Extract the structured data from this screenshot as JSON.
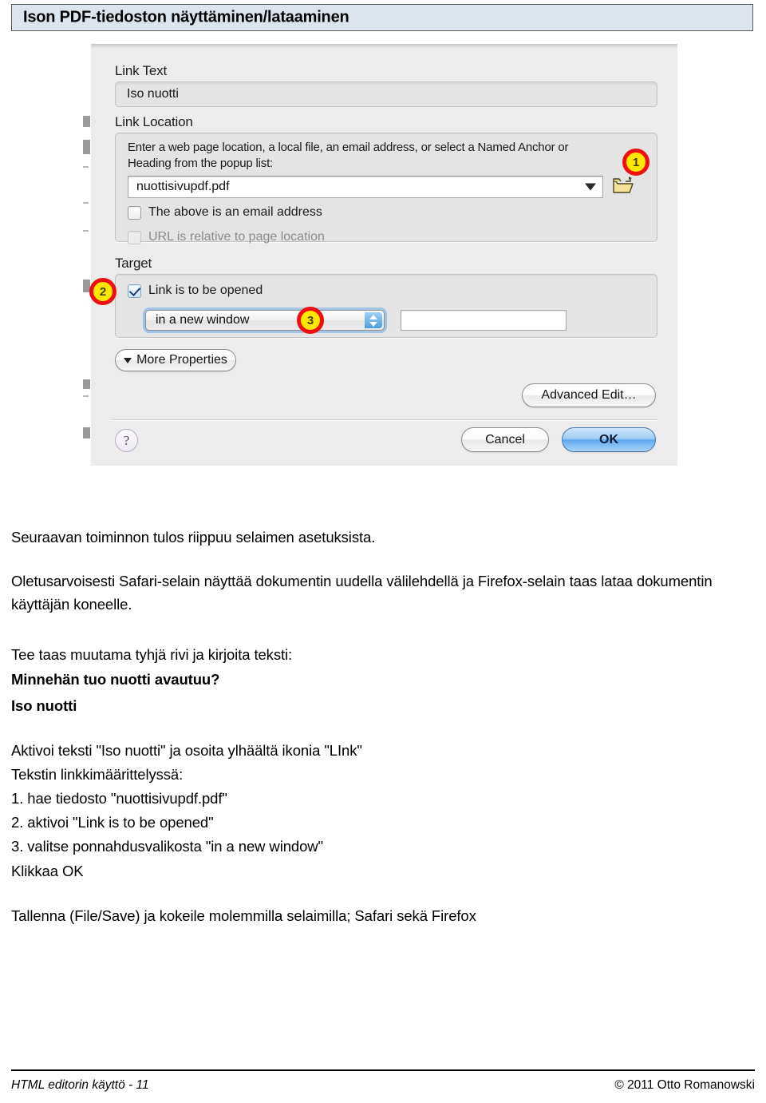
{
  "header": {
    "title": "Ison PDF-tiedoston näyttäminen/lataaminen",
    "band_color": "#dce5ee"
  },
  "dialog": {
    "link_text_label": "Link Text",
    "link_text_value": "Iso nuotti",
    "link_location_label": "Link Location",
    "link_location_help": "Enter a web page location, a local file, an email address, or select a Named Anchor or Heading from the popup list:",
    "link_location_value": "nuottisivupdf.pdf",
    "checkbox_email_label": "The above is an email address",
    "checkbox_email_checked": false,
    "checkbox_relative_label": "URL is relative to page location",
    "checkbox_relative_checked": false,
    "checkbox_relative_disabled": true,
    "target_label": "Target",
    "checkbox_open_label": "Link is to be opened",
    "checkbox_open_checked": true,
    "target_popup_value": "in a new window",
    "target_name_value": "",
    "more_properties_label": "More Properties",
    "advanced_edit_label": "Advanced Edit…",
    "cancel_label": "Cancel",
    "ok_label": "OK",
    "help_label": "?",
    "badges": [
      {
        "number": "1"
      },
      {
        "number": "2"
      },
      {
        "number": "3"
      }
    ],
    "badge_fill": "#ffe800",
    "badge_ring": "#ee1010"
  },
  "body": {
    "p1": "Seuraavan toiminnon tulos riippuu selaimen asetuksista.",
    "p2": "Oletusarvoisesti Safari-selain näyttää dokumentin uudella välilehdellä ja Firefox-selain taas lataa dokumentin käyttäjän koneelle.",
    "p3": "Tee taas muutama tyhjä rivi ja kirjoita teksti:",
    "p4": "Minnehän tuo nuotti avautuu?",
    "p5": "Iso nuotti",
    "p6": "Aktivoi teksti \"Iso nuotti\" ja osoita ylhäältä ikonia \"LInk\"",
    "p7": "Tekstin linkkimäärittelyssä:",
    "p8": "1. hae tiedosto \"nuottisivupdf.pdf\"",
    "p9": "2. aktivoi \"Link is to be opened\"",
    "p10": "3. valitse ponnahdusvalikosta \"in a new window\"",
    "p11": "Klikkaa OK",
    "p12": "Tallenna (File/Save) ja kokeile molemmilla selaimilla; Safari sekä Firefox"
  },
  "footer": {
    "left": "HTML editorin käyttö - 11",
    "right": "© 2011 Otto Romanowski"
  }
}
